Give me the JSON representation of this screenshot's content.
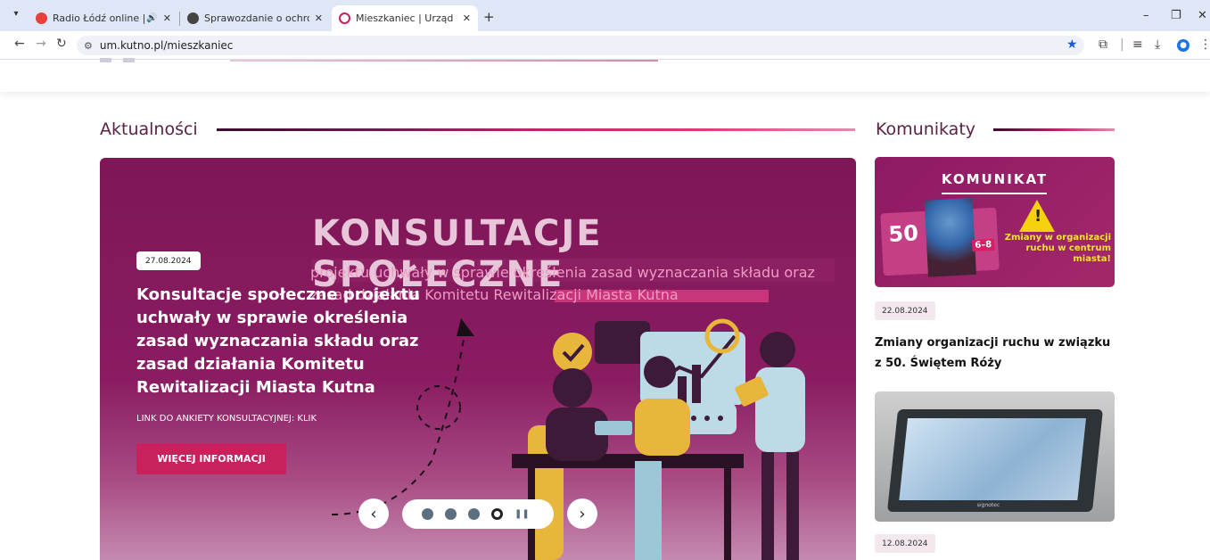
{
  "browser": {
    "tabs": [
      {
        "title": "Radio Łódź online | Online",
        "favicon_color": "#e8403a",
        "active": false,
        "audio": "🔊"
      },
      {
        "title": "Sprawozdanie o ochronie zabyt",
        "favicon_color": "#444444",
        "active": false
      },
      {
        "title": "Mieszkaniec | Urząd Miasta Kut",
        "favicon_color": "#c8215d",
        "active": true
      }
    ],
    "new_tab": "+",
    "url": "um.kutno.pl/mieszkaniec"
  },
  "page": {
    "news_heading": "Aktualności",
    "notices_heading": "Komunikaty",
    "hero": {
      "big_title": "KONSULTACJE SPOŁECZNE",
      "subtitle": "projektu uchwały w sprawie określenia zasad wyznaczania składu oraz zasad działania Komitetu Rewitalizacji Miasta Kutna",
      "date": "27.08.2024",
      "headline": "Konsultacje społeczne projektu uchwały w sprawie określenia zasad wyznaczania składu oraz zasad działania Komitetu Rewitalizacji Miasta Kutna",
      "link_text": "LINK DO ANKIETY KONSULTACYJNEJ: KLIK",
      "more_button": "WIĘCEJ INFORMACJI",
      "slide_count": 4,
      "active_slide": 4
    },
    "notices": [
      {
        "image_title": "KOMUNIKAT",
        "image_sub": "Zmiany w organizacji ruchu w centrum miasta!",
        "image_badge_number": "50",
        "image_badge_dates": "6–8",
        "date": "22.08.2024",
        "title": "Zmiany organizacji ruchu w związku z 50. Świętem Róży"
      },
      {
        "date": "12.08.2024",
        "image_brand": "signotec"
      }
    ]
  },
  "colors": {
    "brand_plum": "#7e1657",
    "brand_pink": "#c8215d",
    "heading": "#5a2245"
  }
}
